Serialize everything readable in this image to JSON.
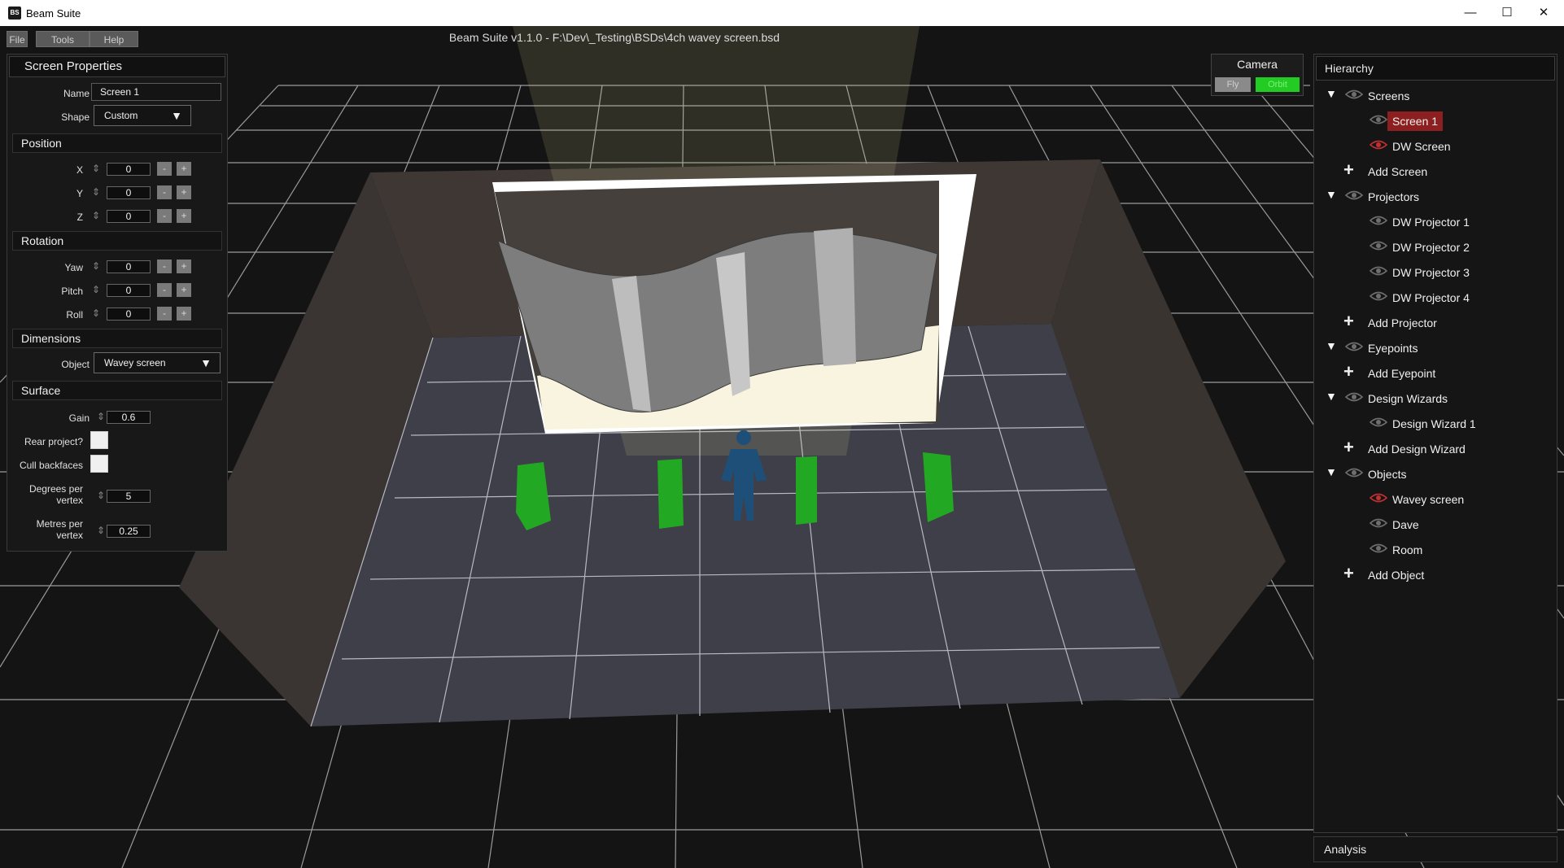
{
  "window": {
    "title": "Beam Suite",
    "icon_text": "BS",
    "minimize": "—",
    "maximize": "☐",
    "close": "✕"
  },
  "menu": {
    "file": "File",
    "tools": "Tools",
    "help": "Help"
  },
  "document_title": "Beam Suite v1.1.0 -  F:\\Dev\\_Testing\\BSDs\\4ch wavey screen.bsd",
  "properties": {
    "title": "Screen Properties",
    "name_label": "Name",
    "name_value": "Screen 1",
    "shape_label": "Shape",
    "shape_value": "Custom",
    "position_section": "Position",
    "x_label": "X",
    "x_value": "0",
    "y_label": "Y",
    "y_value": "0",
    "z_label": "Z",
    "z_value": "0",
    "rotation_section": "Rotation",
    "yaw_label": "Yaw",
    "yaw_value": "0",
    "pitch_label": "Pitch",
    "pitch_value": "0",
    "roll_label": "Roll",
    "roll_value": "0",
    "dimensions_section": "Dimensions",
    "object_label": "Object",
    "object_value": "Wavey screen",
    "surface_section": "Surface",
    "gain_label": "Gain",
    "gain_value": "0.6",
    "rear_project_label": "Rear project?",
    "cull_backfaces_label": "Cull backfaces",
    "degrees_label_1": "Degrees per",
    "degrees_label_2": "vertex",
    "degrees_value": "5",
    "metres_label_1": "Metres per",
    "metres_label_2": "vertex",
    "metres_value": "0.25",
    "minus": "-",
    "plus": "+",
    "drag_glyph": "⇕",
    "dropdown_arrow": "▼"
  },
  "camera": {
    "title": "Camera",
    "fly": "Fly",
    "orbit": "Orbit",
    "active": "Orbit"
  },
  "hierarchy": {
    "title": "Hierarchy",
    "screens": "Screens",
    "screen_1": "Screen 1",
    "dw_screen": "DW Screen",
    "add_screen": "Add Screen",
    "projectors": "Projectors",
    "projector_1": "DW Projector 1",
    "projector_2": "DW Projector 2",
    "projector_3": "DW Projector 3",
    "projector_4": "DW Projector 4",
    "add_projector": "Add Projector",
    "eyepoints": "Eyepoints",
    "add_eyepoint": "Add Eyepoint",
    "design_wizards": "Design Wizards",
    "design_wizard_1": "Design Wizard 1",
    "add_design_wizard": "Add Design Wizard",
    "objects": "Objects",
    "wavey_screen": "Wavey screen",
    "dave": "Dave",
    "room": "Room",
    "add_object": "Add Object",
    "expand_glyph": "▼",
    "plus_glyph": "+"
  },
  "analysis": {
    "title": "Analysis"
  },
  "colors": {
    "background": "#141414",
    "selected": "#8c1f1f",
    "orbit_active": "#22cc22",
    "projector_green": "#22a822",
    "person_blue": "#1e4f78",
    "eye_red": "#c03030"
  }
}
